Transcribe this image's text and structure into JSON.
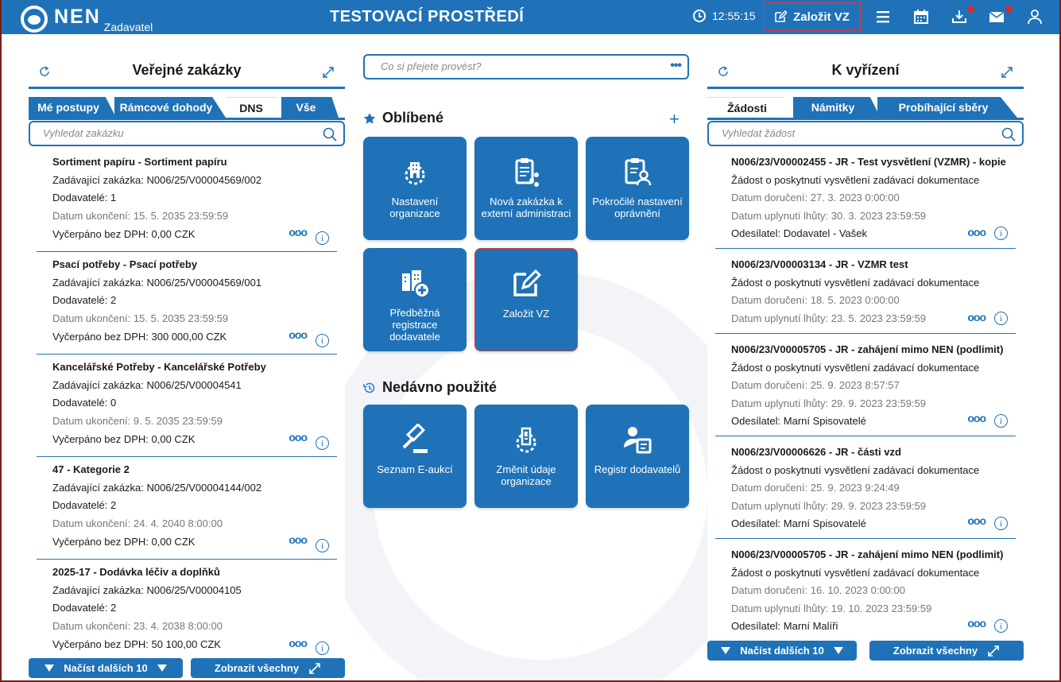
{
  "header": {
    "logo_text": "NEN",
    "logo_sub": "Zadavatel",
    "env_title": "TESTOVACÍ PROSTŘEDÍ",
    "time": "12:55:15",
    "create_button": "Založit VZ"
  },
  "left_panel": {
    "title": "Veřejné zakázky",
    "tabs": [
      "Mé postupy",
      "Rámcové dohody",
      "DNS",
      "Vše"
    ],
    "active_tab": "DNS",
    "search_placeholder": "Vyhledat zakázku",
    "items": [
      {
        "title": "Sortiment papíru - Sortiment papíru",
        "parent": "Zadávající zakázka: N006/25/V00004569/002",
        "suppliers": "Dodavatelé: 1",
        "end_date": "Datum ukončení: 15. 5. 2035 23:59:59",
        "spent": "Vyčerpáno bez DPH: 0,00 CZK"
      },
      {
        "title": "Psací potřeby - Psací potřeby",
        "parent": "Zadávající zakázka: N006/25/V00004569/001",
        "suppliers": "Dodavatelé: 2",
        "end_date": "Datum ukončení: 15. 5. 2035 23:59:59",
        "spent": "Vyčerpáno bez DPH: 300 000,00 CZK"
      },
      {
        "title": "Kancelářské Potřeby - Kancelářské Potřeby",
        "parent": "Zadávající zakázka: N006/25/V00004541",
        "suppliers": "Dodavatelé: 0",
        "end_date": "Datum ukončení: 9. 5. 2035 23:59:59",
        "spent": "Vyčerpáno bez DPH: 0,00 CZK"
      },
      {
        "title": "47 - Kategorie 2",
        "parent": "Zadávající zakázka: N006/25/V00004144/002",
        "suppliers": "Dodavatelé: 2",
        "end_date": "Datum ukončení: 24. 4. 2040 8:00:00",
        "spent": "Vyčerpáno bez DPH: 0,00 CZK"
      },
      {
        "title": "2025-17 - Dodávka léčiv a doplňků",
        "parent": "Zadávající zakázka: N006/25/V00004105",
        "suppliers": "Dodavatelé: 2",
        "end_date": "Datum ukončení: 23. 4. 2038 8:00:00",
        "spent": "Vyčerpáno bez DPH: 50 100,00 CZK"
      }
    ],
    "load_more": "Načíst dalších 10",
    "show_all": "Zobrazit všechny"
  },
  "middle": {
    "command_placeholder": "Co si přejete provést?",
    "favorites_title": "Oblíbené",
    "favorites": [
      {
        "label": "Nastavení organizace",
        "icon": "gear-building-icon"
      },
      {
        "label": "Nová zakázka k externí administraci",
        "icon": "clipboard-share-icon"
      },
      {
        "label": "Pokročilé nastavení oprávnění",
        "icon": "clipboard-user-icon"
      },
      {
        "label": "Předběžná registrace dodavatele",
        "icon": "building-plus-icon"
      },
      {
        "label": "Založit VZ",
        "icon": "edit-icon"
      }
    ],
    "recent_title": "Nedávno použité",
    "recent": [
      {
        "label": "Seznam E-aukcí",
        "icon": "gavel-icon"
      },
      {
        "label": "Změnit údaje organizace",
        "icon": "gear-building-icon"
      },
      {
        "label": "Registr dodavatelů",
        "icon": "user-card-icon"
      }
    ]
  },
  "right_panel": {
    "title": "K vyřízení",
    "tabs": [
      "Žádosti",
      "Námitky",
      "Probíhající sběry"
    ],
    "active_tab": "Žádosti",
    "search_placeholder": "Vyhledat žádost",
    "items": [
      {
        "title": "N006/23/V00002455 - JR - Test vysvětlení (VZMR) - kopie",
        "type": "Žádost o poskytnutí vysvětlení zadávací dokumentace",
        "delivered": "Datum doručení: 27. 3. 2023 0:00:00",
        "deadline": "Datum uplynutí lhůty: 30. 3. 2023 23:59:59",
        "sender": "Odesílatel: Dodavatel - Vašek"
      },
      {
        "title": "N006/23/V00003134 - JR - VZMR test",
        "type": "Žádost o poskytnutí vysvětlení zadávací dokumentace",
        "delivered": "Datum doručení: 18. 5. 2023 0:00:00",
        "deadline": "Datum uplynutí lhůty: 23. 5. 2023 23:59:59",
        "sender": ""
      },
      {
        "title": "N006/23/V00005705 - JR - zahájení mimo NEN (podlimit)",
        "type": "Žádost o poskytnutí vysvětlení zadávací dokumentace",
        "delivered": "Datum doručení: 25. 9. 2023 8:57:57",
        "deadline": "Datum uplynutí lhůty: 29. 9. 2023 23:59:59",
        "sender": "Odesílatel: Marní Spisovatelé"
      },
      {
        "title": "N006/23/V00006626 - JR - části vzd",
        "type": "Žádost o poskytnutí vysvětlení zadávací dokumentace",
        "delivered": "Datum doručení: 25. 9. 2023 9:24:49",
        "deadline": "Datum uplynutí lhůty: 29. 9. 2023 23:59:59",
        "sender": "Odesílatel: Marní Spisovatelé"
      },
      {
        "title": "N006/23/V00005705 - JR - zahájení mimo NEN (podlimit)",
        "type": "Žádost o poskytnutí vysvětlení zadávací dokumentace",
        "delivered": "Datum doručení: 16. 10. 2023 0:00:00",
        "deadline": "Datum uplynutí lhůty: 19. 10. 2023 23:59:59",
        "sender": "Odesílatel: Marní Malíři"
      }
    ],
    "load_more": "Načíst dalších 10",
    "show_all": "Zobrazit všechny"
  },
  "colors": {
    "brand": "#1f72b8",
    "alert": "#d42b2b",
    "highlight_border": "#e03b3b"
  }
}
